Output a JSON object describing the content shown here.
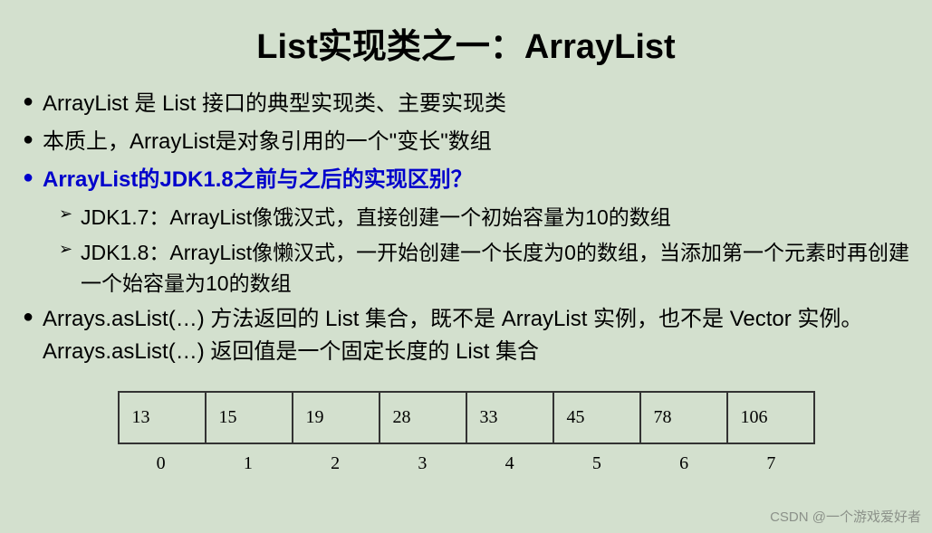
{
  "title": "List实现类之一：ArrayList",
  "bullets": [
    {
      "text": "ArrayList 是 List 接口的典型实现类、主要实现类",
      "style": "normal"
    },
    {
      "text": "本质上，ArrayList是对象引用的一个\"变长\"数组",
      "style": "normal"
    },
    {
      "text": "ArrayList的JDK1.8之前与之后的实现区别？",
      "style": "blue"
    }
  ],
  "sub_bullets": [
    {
      "text": "JDK1.7：ArrayList像饿汉式，直接创建一个初始容量为10的数组"
    },
    {
      "text": "JDK1.8：ArrayList像懒汉式，一开始创建一个长度为0的数组，当添加第一个元素时再创建一个始容量为10的数组"
    }
  ],
  "bullets_after": [
    {
      "text": "Arrays.asList(…) 方法返回的 List 集合，既不是 ArrayList 实例，也不是 Vector 实例。 Arrays.asList(…)  返回值是一个固定长度的 List 集合",
      "style": "normal"
    }
  ],
  "chart_data": {
    "type": "table",
    "values": [
      13,
      15,
      19,
      28,
      33,
      45,
      78,
      106
    ],
    "indices": [
      0,
      1,
      2,
      3,
      4,
      5,
      6,
      7
    ]
  },
  "watermark": "CSDN @一个游戏爱好者"
}
